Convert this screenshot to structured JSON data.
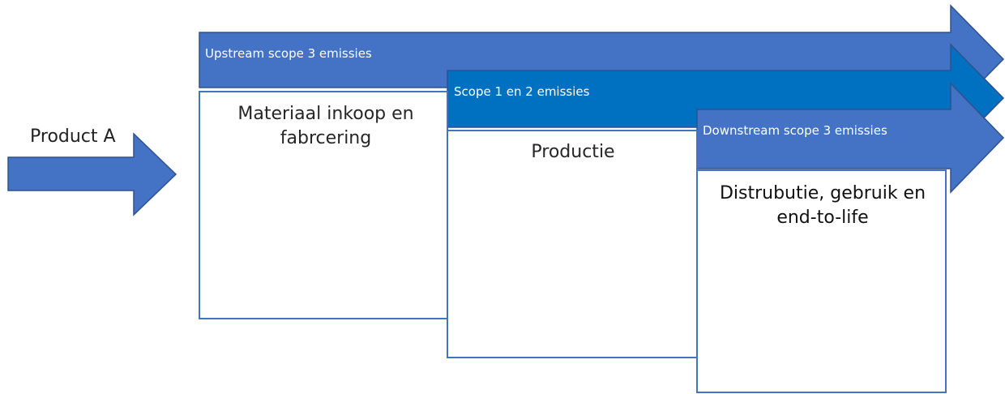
{
  "diagram": {
    "input_label": "Product A",
    "scopes": [
      {
        "arrow_label": "Upstream scope 3 emissies",
        "stage_label": "Materiaal inkoop en fabrcering"
      },
      {
        "arrow_label": "Scope 1 en 2 emissies",
        "stage_label": "Productie"
      },
      {
        "arrow_label": "Downstream scope 3 emissies",
        "stage_label": "Distrubutie, gebruik en end-to-life"
      }
    ],
    "colors": {
      "upstream_arrow": "#4472C4",
      "scope12_arrow": "#0070C0",
      "downstream_arrow": "#4472C4",
      "input_arrow": "#4472C4",
      "arrow_outline": "#2F528F",
      "box_outline": "#4472C4",
      "box_fill": "#FFFFFF"
    }
  }
}
